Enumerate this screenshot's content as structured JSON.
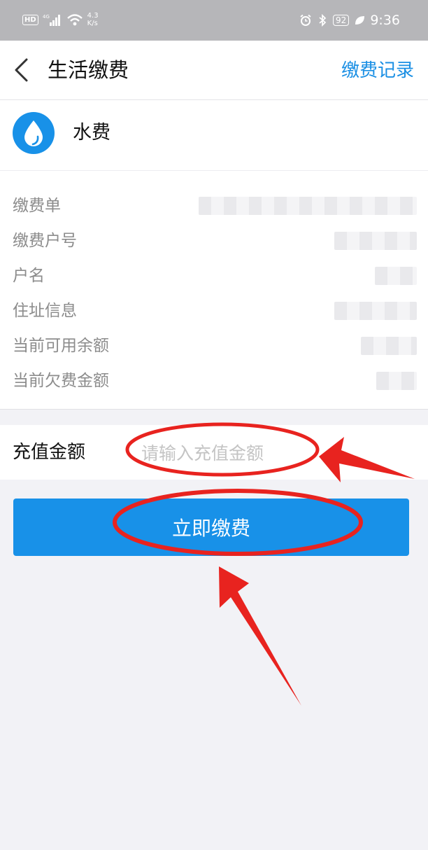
{
  "status_bar": {
    "hd": "HD",
    "network": "4G",
    "speed_value": "4.3",
    "speed_unit": "K/s",
    "battery": "92",
    "time": "9:36"
  },
  "nav": {
    "title": "生活缴费",
    "action": "缴费记录"
  },
  "service": {
    "name": "水费",
    "icon": "water-drop-icon"
  },
  "info": [
    {
      "label": "缴费单"
    },
    {
      "label": "缴费户号"
    },
    {
      "label": "户名"
    },
    {
      "label": "住址信息"
    },
    {
      "label": "当前可用余额"
    },
    {
      "label": "当前欠费金额"
    }
  ],
  "recharge": {
    "label": "充值金额",
    "placeholder": "请输入充值金额",
    "value": ""
  },
  "pay_button": {
    "label": "立即缴费"
  },
  "colors": {
    "accent": "#1891e8",
    "link": "#1a8fe4",
    "annotation": "#e8231f",
    "status_bar": "#b6b6b9",
    "page_bg": "#f2f2f6"
  }
}
